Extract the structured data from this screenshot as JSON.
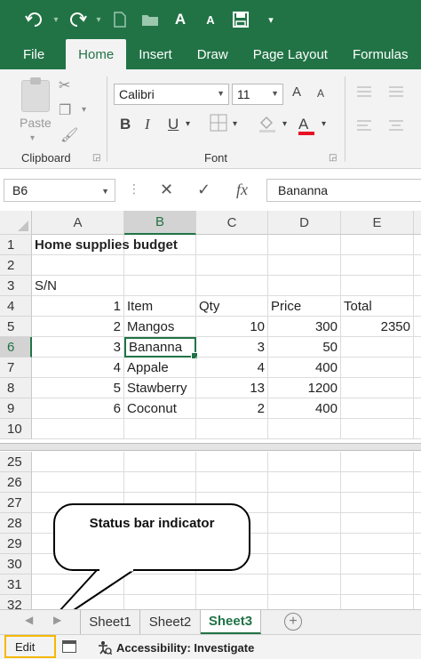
{
  "quick_access": {
    "undo_icon": "undo-icon",
    "redo_icon": "redo-icon",
    "new_icon": "new-file-icon",
    "open_icon": "open-folder-icon",
    "grow_font_icon": "increase-font-icon",
    "shrink_font_icon": "decrease-font-icon",
    "save_icon": "save-icon",
    "customize_icon": "customize-icon",
    "grow_glyph": "A",
    "shrink_glyph": "A"
  },
  "ribbon_tabs": [
    "File",
    "Home",
    "Insert",
    "Draw",
    "Page Layout",
    "Formulas"
  ],
  "active_tab": "Home",
  "clipboard": {
    "paste_label": "Paste",
    "group_label": "Clipboard"
  },
  "font": {
    "name": "Calibri",
    "size": "11",
    "grow_label": "A",
    "shrink_label": "A",
    "bold_label": "B",
    "italic_label": "I",
    "underline_label": "U",
    "font_color_label": "A",
    "group_label": "Font",
    "font_color": "#e81123"
  },
  "formula_bar": {
    "name_box": "B6",
    "formula": "Bananna"
  },
  "columns": [
    "A",
    "B",
    "C",
    "D",
    "E"
  ],
  "rows_top": [
    {
      "num": "1",
      "A": "Home supplies budget",
      "B": "",
      "C": "",
      "D": "",
      "E": ""
    },
    {
      "num": "2",
      "A": "",
      "B": "",
      "C": "",
      "D": "",
      "E": ""
    },
    {
      "num": "3",
      "A": "S/N",
      "B": "",
      "C": "",
      "D": "",
      "E": ""
    },
    {
      "num": "4",
      "A": "1",
      "B": "Item",
      "C": "Qty",
      "D": "Price",
      "E": "Total"
    },
    {
      "num": "5",
      "A": "2",
      "B": "Mangos",
      "C": "10",
      "D": "300",
      "E": "2350"
    },
    {
      "num": "6",
      "A": "3",
      "B": "Bananna",
      "C": "3",
      "D": "50",
      "E": ""
    },
    {
      "num": "7",
      "A": "4",
      "B": "Appale",
      "C": "4",
      "D": "400",
      "E": ""
    },
    {
      "num": "8",
      "A": "5",
      "B": "Stawberry",
      "C": "13",
      "D": "1200",
      "E": ""
    },
    {
      "num": "9",
      "A": "6",
      "B": "Coconut",
      "C": "2",
      "D": "400",
      "E": ""
    },
    {
      "num": "10",
      "A": "",
      "B": "",
      "C": "",
      "D": "",
      "E": ""
    }
  ],
  "rows_bottom": [
    "25",
    "26",
    "27",
    "28",
    "29",
    "30",
    "31",
    "32"
  ],
  "callout": {
    "text": "Status bar indicator"
  },
  "sheet_tabs": [
    "Sheet1",
    "Sheet2",
    "Sheet3"
  ],
  "active_sheet": "Sheet3",
  "add_sheet_label": "+",
  "status_bar": {
    "mode": "Edit",
    "accessibility": "Accessibility: Investigate"
  },
  "colors": {
    "accent": "#217346",
    "callout_highlight": "#f5b800"
  }
}
